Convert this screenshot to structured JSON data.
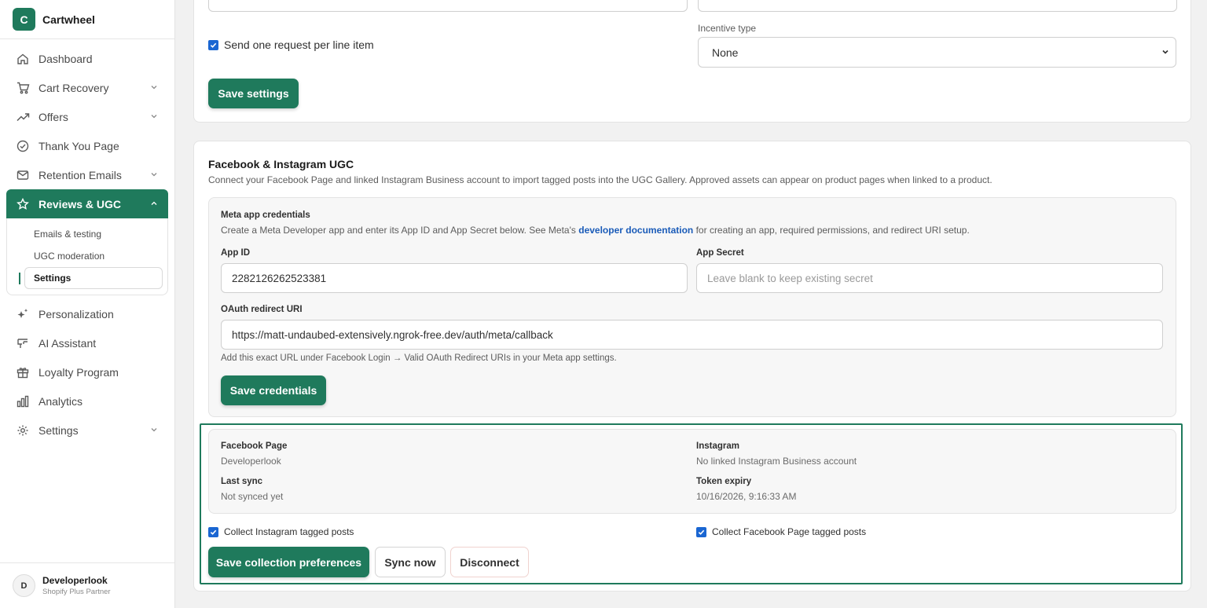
{
  "brand": {
    "initial": "C",
    "name": "Cartwheel"
  },
  "nav": {
    "items": [
      {
        "label": "Dashboard",
        "icon": "home-icon"
      },
      {
        "label": "Cart Recovery",
        "icon": "cart-icon"
      },
      {
        "label": "Offers",
        "icon": "trend-icon"
      },
      {
        "label": "Thank You Page",
        "icon": "check-circle-icon"
      },
      {
        "label": "Retention Emails",
        "icon": "mail-icon"
      },
      {
        "label": "Reviews & UGC",
        "icon": "star-icon"
      },
      {
        "label": "Personalization",
        "icon": "sparkle-icon"
      },
      {
        "label": "AI Assistant",
        "icon": "assistant-icon"
      },
      {
        "label": "Loyalty Program",
        "icon": "gift-icon"
      },
      {
        "label": "Analytics",
        "icon": "bar-chart-icon"
      },
      {
        "label": "Settings",
        "icon": "gear-icon"
      }
    ],
    "sub_items": [
      "Emails & testing",
      "UGC moderation",
      "Settings"
    ]
  },
  "profile": {
    "initial": "D",
    "name": "Developerlook",
    "role": "Shopify Plus Partner"
  },
  "top_card": {
    "checkbox_label": "Send one request per line item",
    "incentive_label": "Incentive type",
    "incentive_value": "None",
    "save_label": "Save settings"
  },
  "ugc": {
    "title": "Facebook & Instagram UGC",
    "description": "Connect your Facebook Page and linked Instagram Business account to import tagged posts into the UGC Gallery. Approved assets can appear on product pages when linked to a product.",
    "credentials": {
      "title": "Meta app credentials",
      "desc_before": "Create a Meta Developer app and enter its App ID and App Secret below. See Meta's ",
      "desc_link": "developer documentation",
      "desc_after": " for creating an app, required permissions, and redirect URI setup.",
      "app_id_label": "App ID",
      "app_id_value": "2282126262523381",
      "app_secret_label": "App Secret",
      "app_secret_placeholder": "Leave blank to keep existing secret",
      "redirect_label": "OAuth redirect URI",
      "redirect_value": "https://matt-undaubed-extensively.ngrok-free.dev/auth/meta/callback",
      "redirect_help": "Add this exact URL under Facebook Login → Valid OAuth Redirect URIs in your Meta app settings.",
      "save_label": "Save credentials"
    },
    "connection": {
      "facebook_label": "Facebook Page",
      "facebook_value": "Developerlook",
      "instagram_label": "Instagram",
      "instagram_value": "No linked Instagram Business account",
      "last_sync_label": "Last sync",
      "last_sync_value": "Not synced yet",
      "token_label": "Token expiry",
      "token_value": "10/16/2026, 9:16:33 AM"
    },
    "collect_instagram": "Collect Instagram tagged posts",
    "collect_facebook": "Collect Facebook Page tagged posts",
    "save_prefs_label": "Save collection preferences",
    "sync_label": "Sync now",
    "disconnect_label": "Disconnect"
  },
  "colors": {
    "accent": "#1f7a5c",
    "checkbox": "#1a66d2",
    "link": "#1a5bb8"
  }
}
